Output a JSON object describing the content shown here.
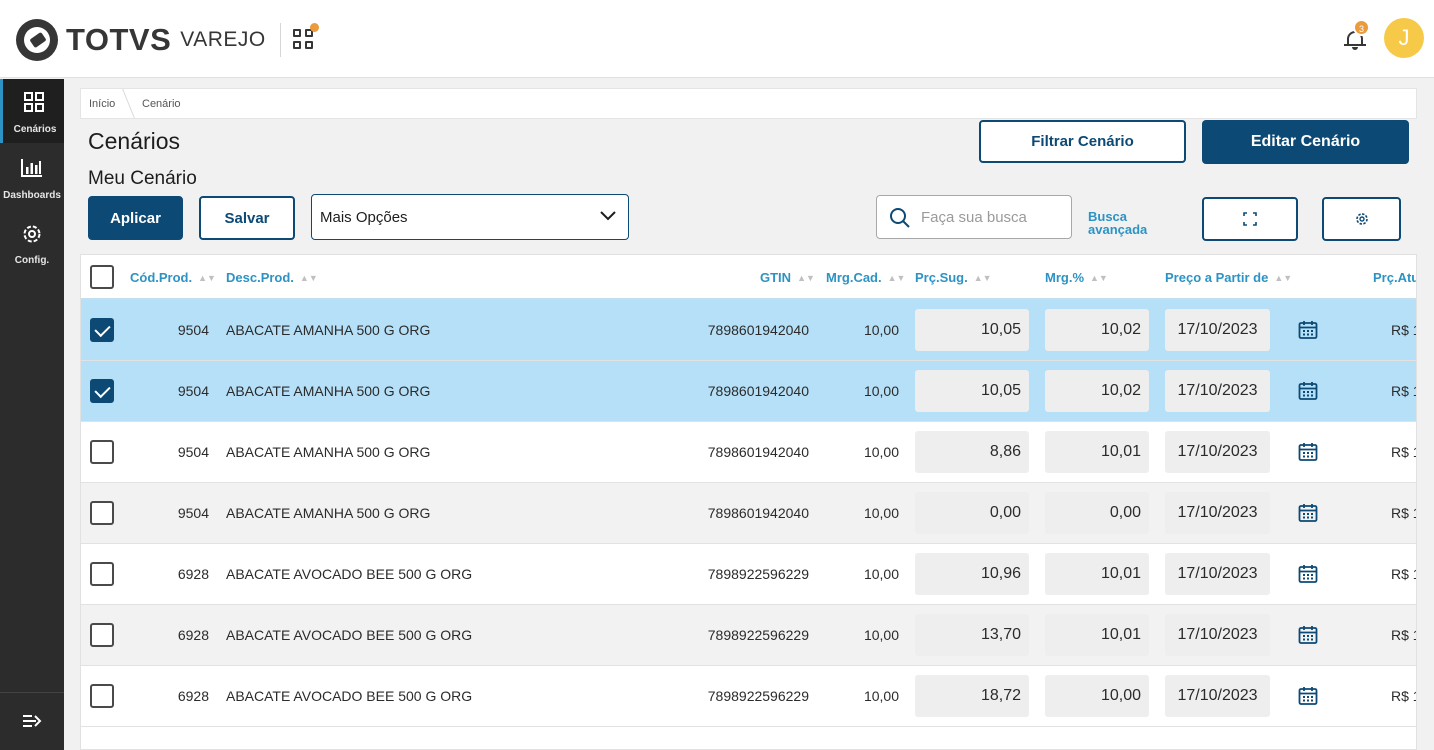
{
  "header": {
    "brand": "TOTVS",
    "brand_sub": "VAREJO",
    "notifications_count": "3",
    "avatar_initial": "J"
  },
  "sidebar": {
    "items": [
      {
        "label": "Cenários",
        "icon": "grid-icon"
      },
      {
        "label": "Dashboards",
        "icon": "bar-chart-icon"
      },
      {
        "label": "Config.",
        "icon": "gear-icon"
      }
    ],
    "collapse_icon": "collapse-menu-icon"
  },
  "breadcrumb": [
    "Início",
    "Cenário"
  ],
  "page": {
    "title": "Cenários",
    "subtitle": "Meu Cenário",
    "filter_button": "Filtrar Cenário",
    "edit_button": "Editar Cenário",
    "apply_button": "Aplicar",
    "save_button": "Salvar",
    "options_select": "Mais Opções",
    "search_placeholder": "Faça sua busca",
    "advanced_search": "Busca avançada"
  },
  "table": {
    "columns": [
      "Cód.Prod.",
      "Desc.Prod.",
      "GTIN",
      "Mrg.Cad.",
      "Prç.Sug.",
      "Mrg.%",
      "Preço a Partir de",
      "Prç.Atu"
    ],
    "rows": [
      {
        "checked": true,
        "code": "9504",
        "desc": "ABACATE AMANHA 500 G ORG",
        "gtin": "7898601942040",
        "mrg_cad": "10,00",
        "prc_sug": "10,05",
        "mrg_pct": "10,02",
        "date": "17/10/2023",
        "prc_atu": "R$ 1"
      },
      {
        "checked": true,
        "code": "9504",
        "desc": "ABACATE AMANHA 500 G ORG",
        "gtin": "7898601942040",
        "mrg_cad": "10,00",
        "prc_sug": "10,05",
        "mrg_pct": "10,02",
        "date": "17/10/2023",
        "prc_atu": "R$ 1"
      },
      {
        "checked": false,
        "code": "9504",
        "desc": "ABACATE AMANHA 500 G ORG",
        "gtin": "7898601942040",
        "mrg_cad": "10,00",
        "prc_sug": "8,86",
        "mrg_pct": "10,01",
        "date": "17/10/2023",
        "prc_atu": "R$ 1"
      },
      {
        "checked": false,
        "code": "9504",
        "desc": "ABACATE AMANHA 500 G ORG",
        "gtin": "7898601942040",
        "mrg_cad": "10,00",
        "prc_sug": "0,00",
        "mrg_pct": "0,00",
        "date": "17/10/2023",
        "prc_atu": "R$ 1"
      },
      {
        "checked": false,
        "code": "6928",
        "desc": "ABACATE AVOCADO BEE 500 G ORG",
        "gtin": "7898922596229",
        "mrg_cad": "10,00",
        "prc_sug": "10,96",
        "mrg_pct": "10,01",
        "date": "17/10/2023",
        "prc_atu": "R$ 1"
      },
      {
        "checked": false,
        "code": "6928",
        "desc": "ABACATE AVOCADO BEE 500 G ORG",
        "gtin": "7898922596229",
        "mrg_cad": "10,00",
        "prc_sug": "13,70",
        "mrg_pct": "10,01",
        "date": "17/10/2023",
        "prc_atu": "R$ 1"
      },
      {
        "checked": false,
        "code": "6928",
        "desc": "ABACATE AVOCADO BEE 500 G ORG",
        "gtin": "7898922596229",
        "mrg_cad": "10,00",
        "prc_sug": "18,72",
        "mrg_pct": "10,00",
        "date": "17/10/2023",
        "prc_atu": "R$ 1"
      }
    ]
  },
  "colors": {
    "primary": "#0c4a75",
    "accent": "#2c93c4",
    "selected_row": "#b6e0f8",
    "badge": "#ea9b3e",
    "avatar": "#f7c948"
  }
}
